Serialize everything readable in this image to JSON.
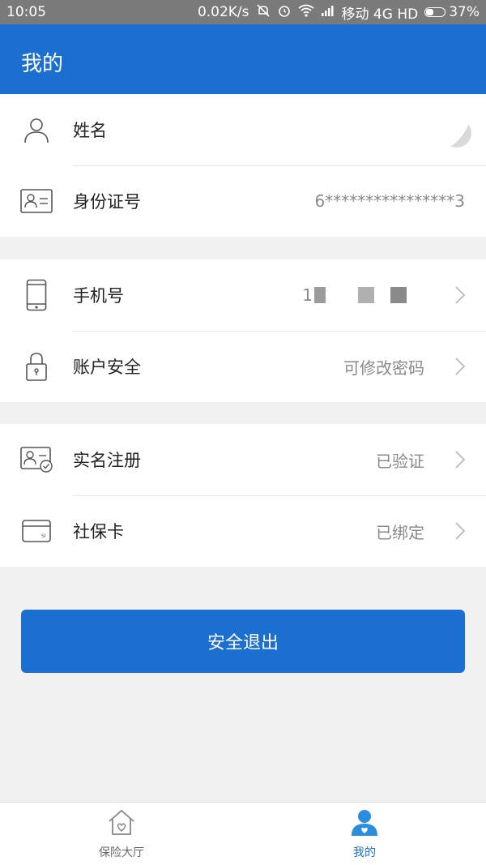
{
  "status_bar": {
    "time": "10:05",
    "speed": "0.02K/s",
    "carrier": "移动 4G HD",
    "battery": "37%",
    "battery_level": 0.37
  },
  "header": {
    "title": "我的"
  },
  "groups": [
    {
      "rows": [
        {
          "label": "姓名",
          "value": ""
        },
        {
          "label": "身份证号",
          "value": "6****************3"
        }
      ]
    },
    {
      "rows": [
        {
          "label": "手机号",
          "value": "1"
        },
        {
          "label": "账户安全",
          "value": "可修改密码"
        }
      ]
    },
    {
      "rows": [
        {
          "label": "实名注册",
          "value": "已验证"
        },
        {
          "label": "社保卡",
          "value": "已绑定"
        }
      ]
    }
  ],
  "logout_label": "安全退出",
  "tabs": [
    {
      "label": "保险大厅",
      "icon": "home-icon",
      "active": false
    },
    {
      "label": "我的",
      "icon": "user-icon",
      "active": true
    }
  ],
  "colors": {
    "accent": "#1b6fd1",
    "status_bar": "#7a7a7a",
    "background": "#f1f1f1"
  }
}
